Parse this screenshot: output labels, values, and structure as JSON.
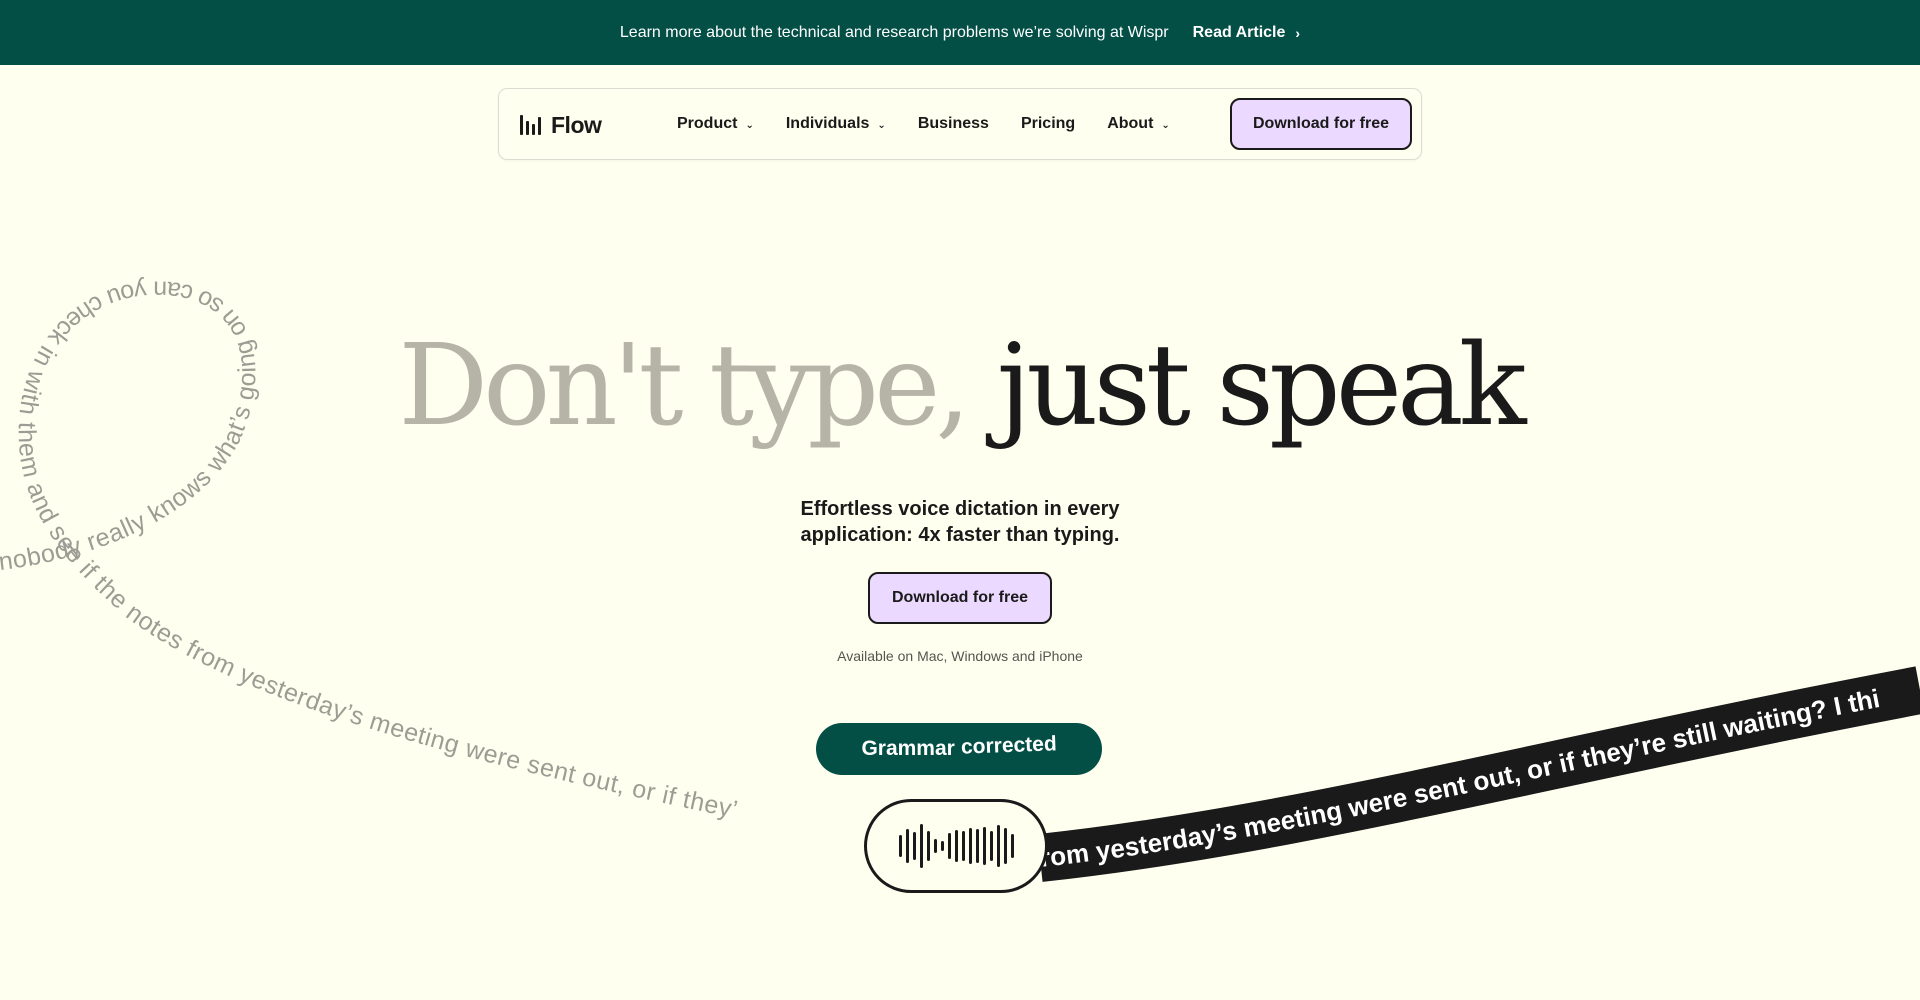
{
  "banner": {
    "text": "Learn more about the technical and research problems we’re solving at Wispr",
    "link_label": "Read Article",
    "link_icon": "chevron-right-icon"
  },
  "nav": {
    "logo_text": "Flow",
    "logo_icon": "waveform-bars-icon",
    "items": [
      {
        "label": "Product",
        "has_dropdown": true
      },
      {
        "label": "Individuals",
        "has_dropdown": true
      },
      {
        "label": "Business",
        "has_dropdown": false
      },
      {
        "label": "Pricing",
        "has_dropdown": false
      },
      {
        "label": "About",
        "has_dropdown": true
      }
    ],
    "cta_label": "Download for free"
  },
  "hero": {
    "headline_light": "Don't type,",
    "headline_dark": "just speak",
    "subhead_line1": "Effortless voice dictation in every",
    "subhead_line2": "application: 4x faster than typing.",
    "cta_label": "Download for free",
    "availability": "Available on Mac, Windows and iPhone"
  },
  "demo": {
    "spiral_text": "nobody really knows what’s going on so can you check in with them and see if the notes from yesterday’s meeting were sent out, or if they’",
    "ribbon_text": "rom yesterday’s meeting were sent out, or if they’re still waiting? I thi",
    "grammar_word1": "Grammar",
    "grammar_word2": "corrected"
  },
  "colors": {
    "background": "#fffff0",
    "banner": "#034f46",
    "accent_purple": "#ecd9ff",
    "dark": "#1a1a1a",
    "muted_text": "#b6b4a6"
  }
}
